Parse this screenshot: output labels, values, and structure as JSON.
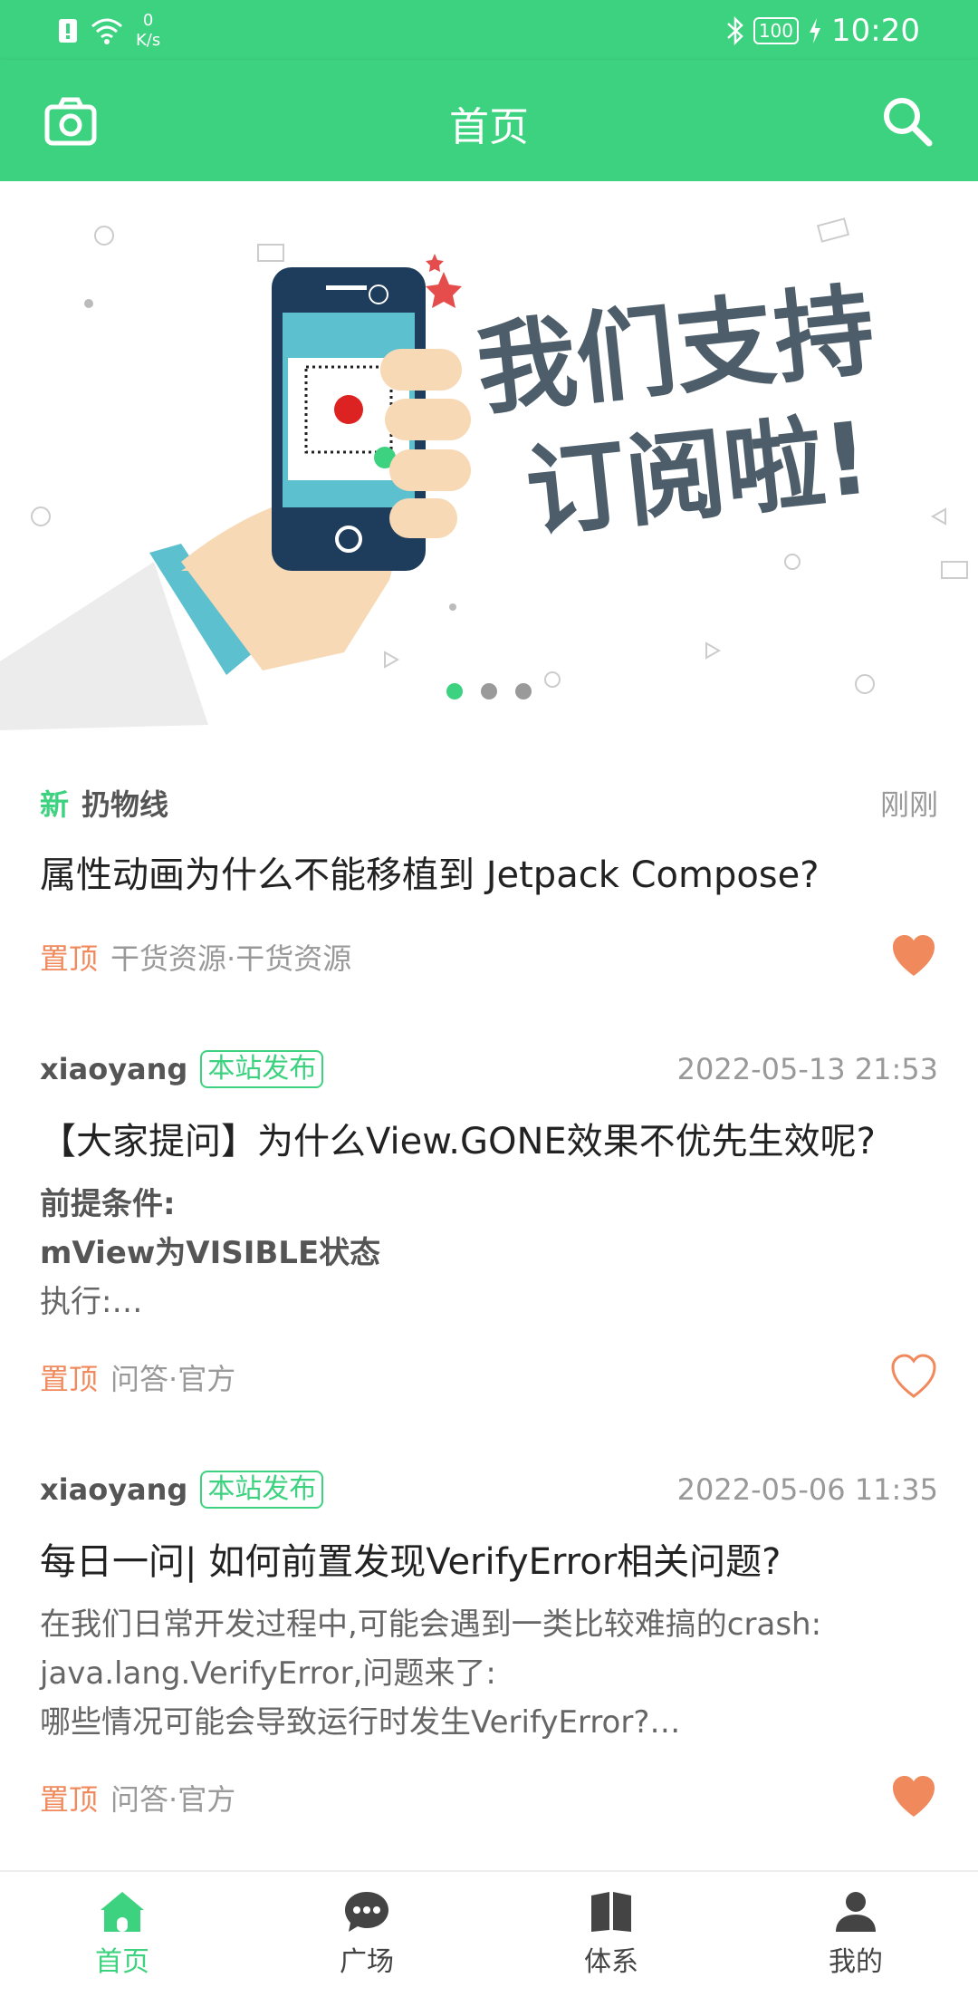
{
  "status_bar": {
    "speed_value": "0",
    "speed_unit": "K/s",
    "battery": "100",
    "time": "10:20"
  },
  "app_bar": {
    "title": "首页",
    "camera_icon": "camera-icon",
    "search_icon": "search-icon"
  },
  "banner": {
    "line1": "我们支持",
    "line2": "订阅啦!",
    "dots": 3,
    "active_dot": 0
  },
  "articles": [
    {
      "new_label": "新",
      "author": "扔物线",
      "time": "刚刚",
      "title": "属性动画为什么不能移植到 Jetpack Compose?",
      "top_label": "置顶",
      "category": "干货资源·干货资源",
      "liked": true
    },
    {
      "author": "xiaoyang",
      "site_label": "本站发布",
      "time": "2022-05-13 21:53",
      "title": "【大家提问】为什么View.GONE效果不优先生效呢?",
      "desc_lines": [
        "前提条件:",
        "mView为VISIBLE状态",
        "执行:…"
      ],
      "top_label": "置顶",
      "category": "问答·官方",
      "liked": false
    },
    {
      "author": "xiaoyang",
      "site_label": "本站发布",
      "time": "2022-05-06 11:35",
      "title": "每日一问| 如何前置发现VerifyError相关问题?",
      "desc_lines": [
        "在我们日常开发过程中,可能会遇到一类比较难搞的crash:",
        "java.lang.VerifyError,问题来了:",
        "哪些情况可能会导致运行时发生VerifyError?…"
      ],
      "top_label": "置顶",
      "category": "问答·官方",
      "liked": true
    }
  ],
  "bottom_nav": [
    {
      "label": "首页",
      "icon": "home-icon",
      "active": true
    },
    {
      "label": "广场",
      "icon": "chat-icon",
      "active": false
    },
    {
      "label": "体系",
      "icon": "book-icon",
      "active": false
    },
    {
      "label": "我的",
      "icon": "person-icon",
      "active": false
    }
  ],
  "colors": {
    "accent": "#3dd27f",
    "top_tag": "#f08a5d",
    "heart": "#f08a5d"
  }
}
